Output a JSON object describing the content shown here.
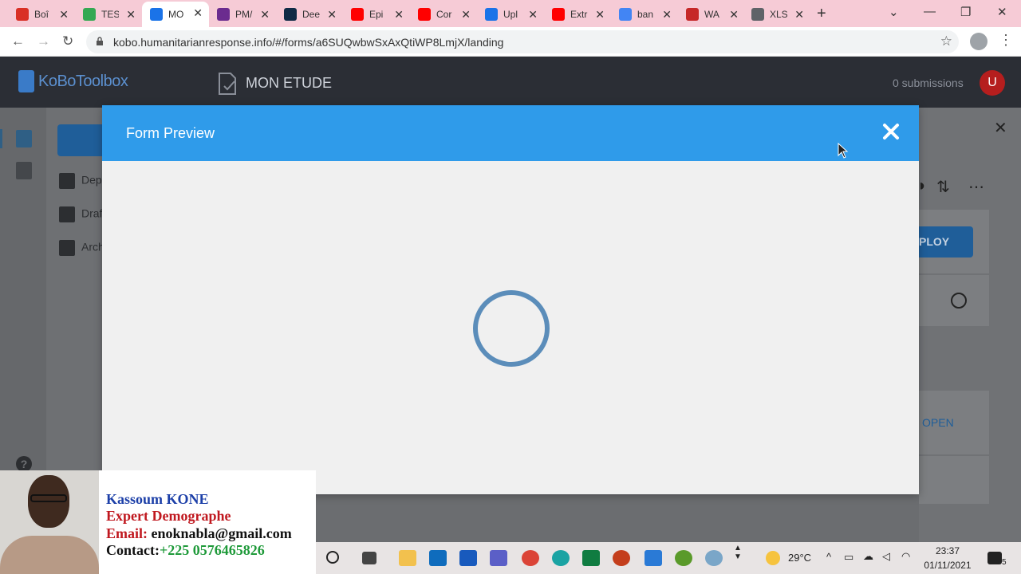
{
  "browser": {
    "tabs": [
      {
        "label": "Boî",
        "favicon": "gmail-icon",
        "color": "#d93025"
      },
      {
        "label": "TES",
        "favicon": "google-drive-icon",
        "color": "#34a853"
      },
      {
        "label": "MO",
        "favicon": "kobo-icon",
        "color": "#1a73e8",
        "active": true
      },
      {
        "label": "PM/",
        "favicon": "pma-icon",
        "color": "#6b2c8f"
      },
      {
        "label": "Dee",
        "favicon": "deepl-icon",
        "color": "#0f2b46"
      },
      {
        "label": "Epi",
        "favicon": "youtube-icon",
        "color": "#ff0000"
      },
      {
        "label": "Cor",
        "favicon": "youtube-icon",
        "color": "#ff0000"
      },
      {
        "label": "Upl",
        "favicon": "kobo-icon",
        "color": "#1a73e8"
      },
      {
        "label": "Extr",
        "favicon": "youtube-icon",
        "color": "#ff0000"
      },
      {
        "label": "ban",
        "favicon": "google-icon",
        "color": "#4285f4"
      },
      {
        "label": "WA",
        "favicon": "maps-icon",
        "color": "#c62828"
      },
      {
        "label": "XLS",
        "favicon": "globe-icon",
        "color": "#5f6368"
      }
    ],
    "url": "kobo.humanitarianresponse.info/#/forms/a6SUQwbwSxAxQtiWP8LmjX/landing"
  },
  "app": {
    "logo": "KoBoToolbox",
    "project_title": "MON ETUDE",
    "submissions": "0 submissions",
    "user_initial": "U",
    "nav": [
      {
        "label": "Dep"
      },
      {
        "label": "Draf"
      },
      {
        "label": "Arch"
      }
    ],
    "deploy_label": "PLOY",
    "open_label": "OPEN"
  },
  "modal": {
    "title": "Form Preview"
  },
  "presenter": {
    "name": "Kassoum KONE",
    "role": "Expert Demographe",
    "email_label": "Email:",
    "email": "enoknabla@gmail.com",
    "contact_label": "Contact:",
    "phone": "+225 0576465826"
  },
  "taskbar": {
    "temperature": "29°C",
    "time": "23:37",
    "date": "01/11/2021",
    "notifications": "5"
  },
  "colors": {
    "modal_header": "#2f9bea",
    "spinner": "#5b8dba",
    "kobo_blue": "#1f5e99",
    "name_color": "#1c3fa8",
    "role_color": "#c0181f",
    "phone_color": "#1f9a3a"
  }
}
